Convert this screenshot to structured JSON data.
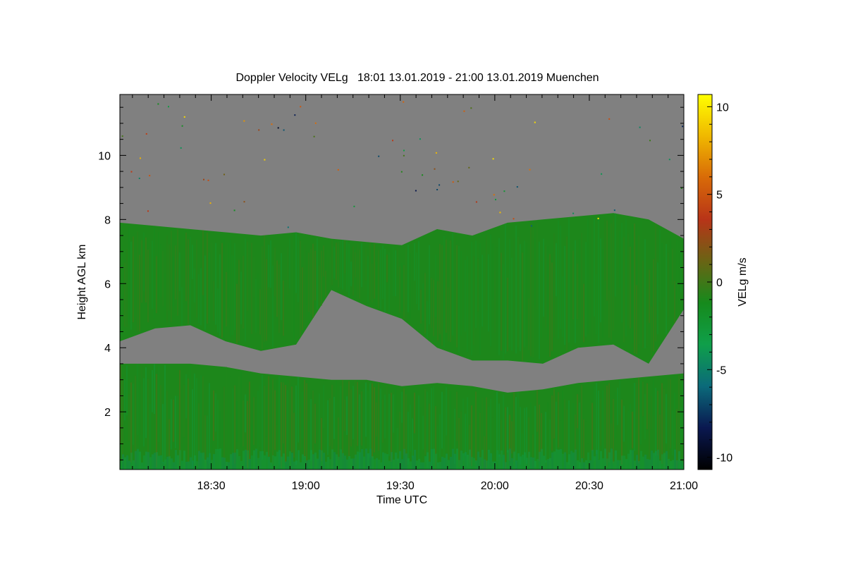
{
  "chart_data": {
    "type": "heatmap",
    "title": "Doppler Velocity VELg   18:01 13.01.2019 - 21:00 13.01.2019 Muenchen",
    "xlabel": "Time UTC",
    "ylabel": "Height AGL km",
    "colorbar_label": "VELg m/s",
    "x_range": [
      "18:01",
      "21:00"
    ],
    "x_ticks": [
      "18:30",
      "19:00",
      "19:30",
      "20:00",
      "20:30",
      "21:00"
    ],
    "y_ticks": [
      2,
      4,
      6,
      8,
      10
    ],
    "ylim": [
      0.2,
      11.9
    ],
    "colorbar_ticks": [
      10,
      5,
      0,
      -5,
      -10
    ],
    "clim": [
      -10.7,
      10.7
    ],
    "background_color": "#808080",
    "colormap": [
      "#000000",
      "#0a1850",
      "#0b6a7a",
      "#0f9f4a",
      "#168a1c",
      "#6a6414",
      "#b83418",
      "#d86a08",
      "#f0b800",
      "#ffff00"
    ],
    "layers": [
      {
        "name": "upper cloud",
        "velocity_ms": -1,
        "top_km": [
          7.9,
          7.8,
          7.7,
          7.6,
          7.5,
          7.6,
          7.4,
          7.3,
          7.2,
          7.7,
          7.5,
          7.9,
          8.0,
          8.1,
          8.2,
          8.0,
          7.4
        ],
        "base_km": [
          4.2,
          4.6,
          4.7,
          4.2,
          3.9,
          4.1,
          5.8,
          5.3,
          4.9,
          4.0,
          3.6,
          3.6,
          3.5,
          4.0,
          4.1,
          3.5,
          5.2
        ]
      },
      {
        "name": "lower cloud",
        "velocity_ms": -1,
        "top_km": [
          3.5,
          3.5,
          3.5,
          3.4,
          3.2,
          3.1,
          3.0,
          3.0,
          2.8,
          2.9,
          2.8,
          2.6,
          2.7,
          2.9,
          3.0,
          3.1,
          3.2
        ],
        "base_km": [
          0.2,
          0.2,
          0.2,
          0.2,
          0.2,
          0.2,
          0.2,
          0.2,
          0.2,
          0.2,
          0.2,
          0.2,
          0.2,
          0.2,
          0.2,
          0.2,
          0.2
        ]
      }
    ]
  }
}
